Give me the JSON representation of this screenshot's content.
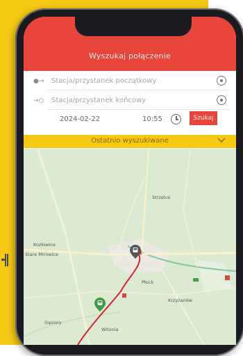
{
  "header": {
    "title": "Wyszukaj połączenie"
  },
  "search": {
    "start_placeholder": "Stacja/przystanek początkowy",
    "end_placeholder": "Stacja/przystanek końcowy",
    "date": "2024-02-22",
    "time": "10:55",
    "button_label": "Szukaj"
  },
  "recent": {
    "label": "Ostatnio wyszukiwane"
  },
  "map": {
    "labels": [
      "Kozłowice",
      "Stare Mirowice",
      "Płock",
      "Krzyżanów",
      "Gąsiory",
      "Witonia",
      "Strzelce"
    ]
  },
  "icons": {
    "start": "start-arrow-icon",
    "end": "end-arrow-icon",
    "locate": "target-icon",
    "clock": "clock-icon",
    "chevron": "chevron-down-icon",
    "train_pin": "train-pin-icon",
    "bus_pin": "bus-pin-icon"
  },
  "colors": {
    "brand_red": "#e8453c",
    "brand_yellow": "#f6c915",
    "map_green": "#dcead3",
    "route": "#d6242c"
  }
}
